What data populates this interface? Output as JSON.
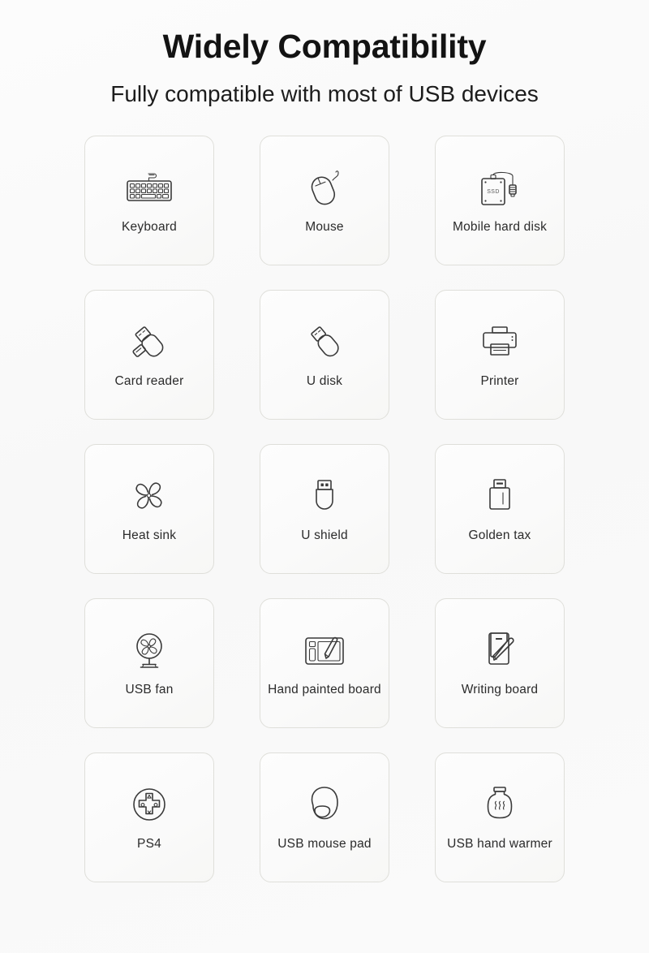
{
  "header": {
    "title": "Widely Compatibility",
    "subtitle": "Fully compatible with most of USB devices"
  },
  "colors": {
    "background": "#fbfbfb",
    "card_border": "#dfdfda",
    "icon_stroke": "#3a3a3a",
    "title_color": "#131313",
    "label_color": "#2b2b2b"
  },
  "devices": [
    {
      "label": "Keyboard",
      "icon": "keyboard-icon"
    },
    {
      "label": "Mouse",
      "icon": "mouse-icon"
    },
    {
      "label": "Mobile hard disk",
      "icon": "external-ssd-icon",
      "icon_text": "SSD"
    },
    {
      "label": "Card reader",
      "icon": "card-reader-icon"
    },
    {
      "label": "U disk",
      "icon": "usb-flash-drive-icon"
    },
    {
      "label": "Printer",
      "icon": "printer-icon"
    },
    {
      "label": "Heat sink",
      "icon": "fan-blades-icon"
    },
    {
      "label": "U shield",
      "icon": "usb-security-key-icon"
    },
    {
      "label": "Golden tax",
      "icon": "usb-tax-dongle-icon"
    },
    {
      "label": "USB fan",
      "icon": "desk-fan-icon"
    },
    {
      "label": "Hand painted board",
      "icon": "graphics-tablet-icon"
    },
    {
      "label": "Writing board",
      "icon": "writing-tablet-icon"
    },
    {
      "label": "PS4",
      "icon": "gamepad-dpad-icon"
    },
    {
      "label": "USB mouse pad",
      "icon": "mouse-pad-icon"
    },
    {
      "label": "USB hand warmer",
      "icon": "hand-warmer-icon"
    }
  ]
}
